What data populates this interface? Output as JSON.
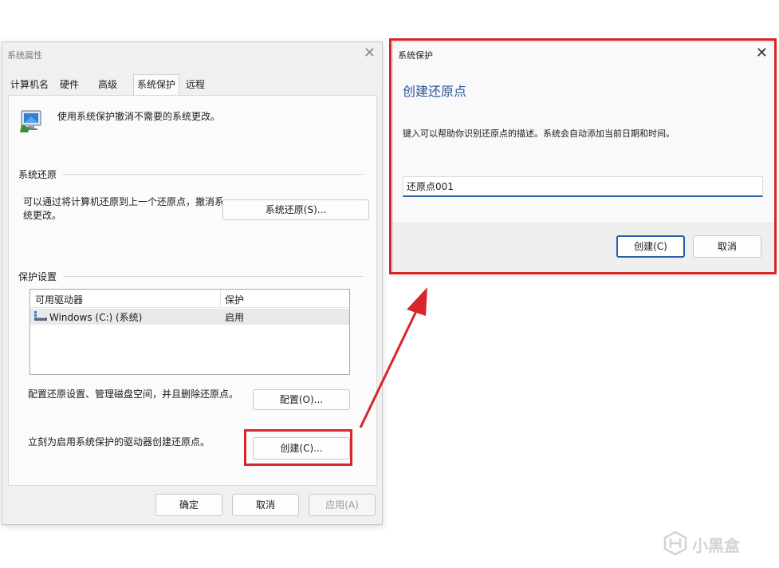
{
  "system_properties": {
    "title": "系统属性",
    "close_glyph": "✕",
    "tabs": [
      {
        "label": "计算机名",
        "active": false
      },
      {
        "label": "硬件",
        "active": false
      },
      {
        "label": "高级",
        "active": false
      },
      {
        "label": "系统保护",
        "active": true
      },
      {
        "label": "远程",
        "active": false
      }
    ],
    "intro_text": "使用系统保护撤消不需要的系统更改。",
    "restore_group": {
      "label": "系统还原",
      "description": "可以通过将计算机还原到上一个还原点，撤消系统更改。",
      "button": "系统还原(S)..."
    },
    "protection_group": {
      "label": "保护设置",
      "columns": [
        "可用驱动器",
        "保护"
      ],
      "rows": [
        {
          "drive": "Windows  (C:) (系统)",
          "protection": "启用"
        }
      ],
      "configure_text": "配置还原设置、管理磁盘空间，并且删除还原点。",
      "configure_button": "配置(O)...",
      "create_text": "立刻为启用系统保护的驱动器创建还原点。",
      "create_button": "创建(C)..."
    },
    "footer": {
      "ok": "确定",
      "cancel": "取消",
      "apply": "应用(A)"
    }
  },
  "create_restore_dialog": {
    "title": "系统保护",
    "close_glyph": "✕",
    "heading": "创建还原点",
    "description": "键入可以帮助你识别还原点的描述。系统会自动添加当前日期和时间。",
    "input_value": "还原点001",
    "create_button": "创建(C)",
    "cancel_button": "取消"
  },
  "watermark": {
    "text": "小黑盒"
  },
  "colors": {
    "highlight": "#d7262b",
    "heading_blue": "#2a5599",
    "input_underline": "#2a5da8"
  }
}
